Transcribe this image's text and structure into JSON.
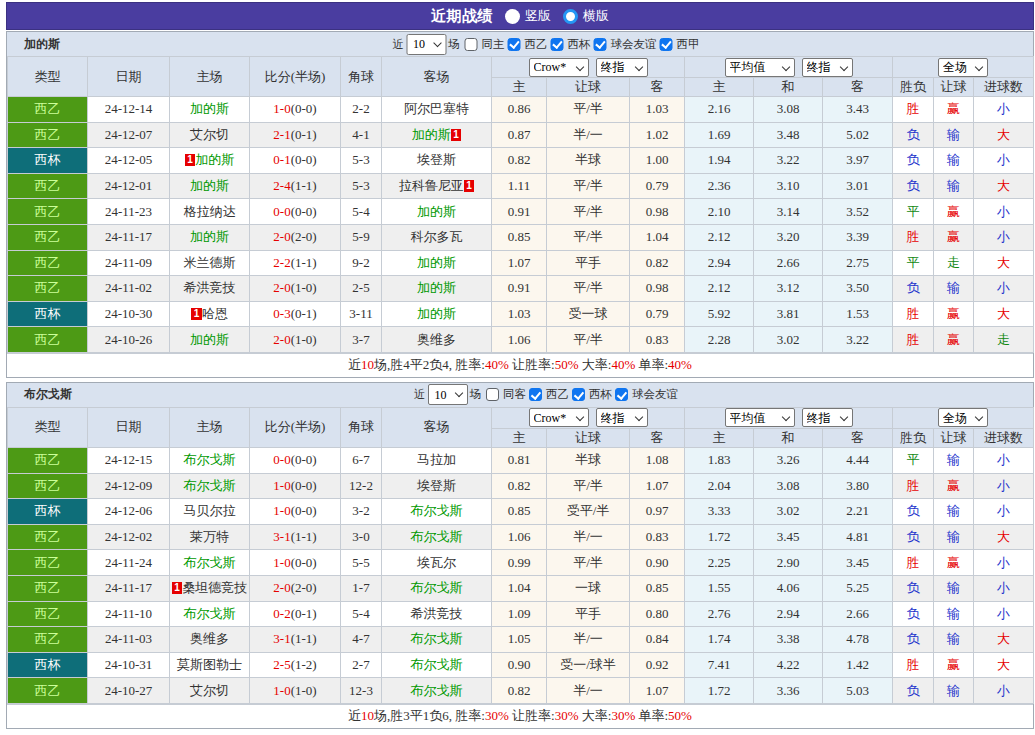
{
  "topbar": {
    "title": "近期战绩",
    "radios": [
      {
        "label": "竖版",
        "checked": false
      },
      {
        "label": "横版",
        "checked": true
      }
    ]
  },
  "header_cols_left": [
    "类型",
    "日期",
    "主场",
    "比分(半场)",
    "角球",
    "客场"
  ],
  "odds_groups": [
    {
      "selects": [
        "Crow*",
        "终指"
      ],
      "cols": [
        "主",
        "让球",
        "客"
      ]
    },
    {
      "selects": [
        "平均值",
        "终指"
      ],
      "cols": [
        "主",
        "和",
        "客"
      ]
    },
    {
      "selects": [
        "全场"
      ],
      "cols": [
        "胜负",
        "让球",
        "进球数"
      ]
    }
  ],
  "colors": {
    "topbar": "#4a3da0",
    "league_badge": "#4d9a15",
    "cup_badge": "#0e6e79",
    "self_team": "#009900",
    "score_red": "#e60000",
    "win_red": "#e60000",
    "lose_blue": "#2233cc",
    "draw_green": "#118811"
  },
  "sections": [
    {
      "team": "加的斯",
      "controls": {
        "prefix": "近",
        "count": "10",
        "suffix": "场",
        "checkboxes": [
          {
            "key": "same-home",
            "label": "同主",
            "checked": false
          },
          {
            "key": "laliga2",
            "label": "西乙",
            "checked": true
          },
          {
            "key": "copa",
            "label": "西杯",
            "checked": true
          },
          {
            "key": "club-friendly",
            "label": "球会友谊",
            "checked": true
          },
          {
            "key": "laliga",
            "label": "西甲",
            "checked": true
          }
        ]
      },
      "rows": [
        {
          "type": "西乙",
          "cup": false,
          "date": "24-12-14",
          "home": {
            "name": "加的斯",
            "self": true,
            "badge": ""
          },
          "score": "1-0",
          "half": "(0-0)",
          "corner": "2-2",
          "away": {
            "name": "阿尔巴塞特",
            "self": false,
            "badge": ""
          },
          "asian": [
            "0.86",
            "平/半",
            "1.03"
          ],
          "euro": [
            "2.16",
            "3.08",
            "3.43"
          ],
          "outcome": [
            [
              "胜",
              "r"
            ],
            [
              "赢",
              "r"
            ],
            [
              "小",
              "b"
            ]
          ]
        },
        {
          "type": "西乙",
          "cup": false,
          "date": "24-12-07",
          "home": {
            "name": "艾尔切",
            "self": false,
            "badge": ""
          },
          "score": "2-1",
          "half": "(0-1)",
          "corner": "4-1",
          "away": {
            "name": "加的斯",
            "self": true,
            "badge": "1"
          },
          "asian": [
            "0.87",
            "半/一",
            "1.02"
          ],
          "euro": [
            "1.69",
            "3.48",
            "5.02"
          ],
          "outcome": [
            [
              "负",
              "b"
            ],
            [
              "输",
              "b"
            ],
            [
              "大",
              "r"
            ]
          ]
        },
        {
          "type": "西杯",
          "cup": true,
          "date": "24-12-05",
          "home": {
            "name": "加的斯",
            "self": true,
            "badge": "1"
          },
          "score": "0-1",
          "half": "(0-0)",
          "corner": "5-3",
          "away": {
            "name": "埃登斯",
            "self": false,
            "badge": ""
          },
          "asian": [
            "0.82",
            "半球",
            "1.00"
          ],
          "euro": [
            "1.94",
            "3.22",
            "3.97"
          ],
          "outcome": [
            [
              "负",
              "b"
            ],
            [
              "输",
              "b"
            ],
            [
              "小",
              "b"
            ]
          ]
        },
        {
          "type": "西乙",
          "cup": false,
          "date": "24-12-01",
          "home": {
            "name": "加的斯",
            "self": true,
            "badge": ""
          },
          "score": "2-4",
          "half": "(1-1)",
          "corner": "5-3",
          "away": {
            "name": "拉科鲁尼亚",
            "self": false,
            "badge": "1"
          },
          "asian": [
            "1.11",
            "平/半",
            "0.79"
          ],
          "euro": [
            "2.36",
            "3.10",
            "3.01"
          ],
          "outcome": [
            [
              "负",
              "b"
            ],
            [
              "输",
              "b"
            ],
            [
              "大",
              "r"
            ]
          ]
        },
        {
          "type": "西乙",
          "cup": false,
          "date": "24-11-23",
          "home": {
            "name": "格拉纳达",
            "self": false,
            "badge": ""
          },
          "score": "0-0",
          "half": "(0-0)",
          "corner": "5-4",
          "away": {
            "name": "加的斯",
            "self": true,
            "badge": ""
          },
          "asian": [
            "0.91",
            "平/半",
            "0.98"
          ],
          "euro": [
            "2.10",
            "3.14",
            "3.52"
          ],
          "outcome": [
            [
              "平",
              "g"
            ],
            [
              "赢",
              "r"
            ],
            [
              "小",
              "b"
            ]
          ]
        },
        {
          "type": "西乙",
          "cup": false,
          "date": "24-11-17",
          "home": {
            "name": "加的斯",
            "self": true,
            "badge": ""
          },
          "score": "2-0",
          "half": "(2-0)",
          "corner": "5-9",
          "away": {
            "name": "科尔多瓦",
            "self": false,
            "badge": ""
          },
          "asian": [
            "0.85",
            "平/半",
            "1.04"
          ],
          "euro": [
            "2.12",
            "3.20",
            "3.39"
          ],
          "outcome": [
            [
              "胜",
              "r"
            ],
            [
              "赢",
              "r"
            ],
            [
              "小",
              "b"
            ]
          ]
        },
        {
          "type": "西乙",
          "cup": false,
          "date": "24-11-09",
          "home": {
            "name": "米兰德斯",
            "self": false,
            "badge": ""
          },
          "score": "2-2",
          "half": "(1-1)",
          "corner": "9-2",
          "away": {
            "name": "加的斯",
            "self": true,
            "badge": ""
          },
          "asian": [
            "1.07",
            "平手",
            "0.82"
          ],
          "euro": [
            "2.94",
            "2.66",
            "2.75"
          ],
          "outcome": [
            [
              "平",
              "g"
            ],
            [
              "走",
              "g"
            ],
            [
              "大",
              "r"
            ]
          ]
        },
        {
          "type": "西乙",
          "cup": false,
          "date": "24-11-02",
          "home": {
            "name": "希洪竞技",
            "self": false,
            "badge": ""
          },
          "score": "2-0",
          "half": "(1-0)",
          "corner": "2-5",
          "away": {
            "name": "加的斯",
            "self": true,
            "badge": ""
          },
          "asian": [
            "0.91",
            "平/半",
            "0.98"
          ],
          "euro": [
            "2.12",
            "3.12",
            "3.50"
          ],
          "outcome": [
            [
              "负",
              "b"
            ],
            [
              "输",
              "b"
            ],
            [
              "小",
              "b"
            ]
          ]
        },
        {
          "type": "西杯",
          "cup": true,
          "date": "24-10-30",
          "home": {
            "name": "哈恩",
            "self": false,
            "badge": "1"
          },
          "score": "0-3",
          "half": "(0-1)",
          "corner": "3-11",
          "away": {
            "name": "加的斯",
            "self": true,
            "badge": ""
          },
          "asian": [
            "1.03",
            "受一球",
            "0.79"
          ],
          "euro": [
            "5.92",
            "3.81",
            "1.53"
          ],
          "outcome": [
            [
              "胜",
              "r"
            ],
            [
              "赢",
              "r"
            ],
            [
              "大",
              "r"
            ]
          ]
        },
        {
          "type": "西乙",
          "cup": false,
          "date": "24-10-26",
          "home": {
            "name": "加的斯",
            "self": true,
            "badge": ""
          },
          "score": "2-0",
          "half": "(1-0)",
          "corner": "3-7",
          "away": {
            "name": "奥维多",
            "self": false,
            "badge": ""
          },
          "asian": [
            "1.06",
            "平/半",
            "0.83"
          ],
          "euro": [
            "2.28",
            "3.02",
            "3.22"
          ],
          "outcome": [
            [
              "胜",
              "r"
            ],
            [
              "赢",
              "r"
            ],
            [
              "走",
              "g"
            ]
          ]
        }
      ],
      "summary": [
        [
          "近",
          "k"
        ],
        [
          "10",
          "r"
        ],
        [
          "场,胜4平2负4, 胜率:",
          "k"
        ],
        [
          "40%",
          "r"
        ],
        [
          " 让胜率:",
          "k"
        ],
        [
          "50%",
          "r"
        ],
        [
          " 大率:",
          "k"
        ],
        [
          "40%",
          "r"
        ],
        [
          " 单率:",
          "k"
        ],
        [
          "40%",
          "r"
        ]
      ]
    },
    {
      "team": "布尔戈斯",
      "controls": {
        "prefix": "近",
        "count": "10",
        "suffix": "场",
        "checkboxes": [
          {
            "key": "same-away",
            "label": "同客",
            "checked": false
          },
          {
            "key": "laliga2",
            "label": "西乙",
            "checked": true
          },
          {
            "key": "copa",
            "label": "西杯",
            "checked": true
          },
          {
            "key": "club-friendly",
            "label": "球会友谊",
            "checked": true
          }
        ]
      },
      "rows": [
        {
          "type": "西乙",
          "cup": false,
          "date": "24-12-15",
          "home": {
            "name": "布尔戈斯",
            "self": true,
            "badge": ""
          },
          "score": "0-0",
          "half": "(0-0)",
          "corner": "6-7",
          "away": {
            "name": "马拉加",
            "self": false,
            "badge": ""
          },
          "asian": [
            "0.81",
            "半球",
            "1.08"
          ],
          "euro": [
            "1.83",
            "3.26",
            "4.44"
          ],
          "outcome": [
            [
              "平",
              "g"
            ],
            [
              "输",
              "b"
            ],
            [
              "小",
              "b"
            ]
          ]
        },
        {
          "type": "西乙",
          "cup": false,
          "date": "24-12-09",
          "home": {
            "name": "布尔戈斯",
            "self": true,
            "badge": ""
          },
          "score": "1-0",
          "half": "(0-0)",
          "corner": "12-2",
          "away": {
            "name": "埃登斯",
            "self": false,
            "badge": ""
          },
          "asian": [
            "0.82",
            "平/半",
            "1.07"
          ],
          "euro": [
            "2.04",
            "3.08",
            "3.80"
          ],
          "outcome": [
            [
              "胜",
              "r"
            ],
            [
              "赢",
              "r"
            ],
            [
              "小",
              "b"
            ]
          ]
        },
        {
          "type": "西杯",
          "cup": true,
          "date": "24-12-06",
          "home": {
            "name": "马贝尔拉",
            "self": false,
            "badge": ""
          },
          "score": "1-0",
          "half": "(0-0)",
          "corner": "3-2",
          "away": {
            "name": "布尔戈斯",
            "self": true,
            "badge": ""
          },
          "asian": [
            "0.85",
            "受平/半",
            "0.97"
          ],
          "euro": [
            "3.33",
            "3.02",
            "2.21"
          ],
          "outcome": [
            [
              "负",
              "b"
            ],
            [
              "输",
              "b"
            ],
            [
              "小",
              "b"
            ]
          ]
        },
        {
          "type": "西乙",
          "cup": false,
          "date": "24-12-02",
          "home": {
            "name": "莱万特",
            "self": false,
            "badge": ""
          },
          "score": "3-1",
          "half": "(1-1)",
          "corner": "3-0",
          "away": {
            "name": "布尔戈斯",
            "self": true,
            "badge": ""
          },
          "asian": [
            "1.06",
            "半/一",
            "0.83"
          ],
          "euro": [
            "1.72",
            "3.45",
            "4.81"
          ],
          "outcome": [
            [
              "负",
              "b"
            ],
            [
              "输",
              "b"
            ],
            [
              "大",
              "r"
            ]
          ]
        },
        {
          "type": "西乙",
          "cup": false,
          "date": "24-11-24",
          "home": {
            "name": "布尔戈斯",
            "self": true,
            "badge": ""
          },
          "score": "1-0",
          "half": "(0-0)",
          "corner": "5-5",
          "away": {
            "name": "埃瓦尔",
            "self": false,
            "badge": ""
          },
          "asian": [
            "0.99",
            "平/半",
            "0.90"
          ],
          "euro": [
            "2.25",
            "2.90",
            "3.45"
          ],
          "outcome": [
            [
              "胜",
              "r"
            ],
            [
              "赢",
              "r"
            ],
            [
              "小",
              "b"
            ]
          ]
        },
        {
          "type": "西乙",
          "cup": false,
          "date": "24-11-17",
          "home": {
            "name": "桑坦德竞技",
            "self": false,
            "badge": "1"
          },
          "score": "2-0",
          "half": "(2-0)",
          "corner": "1-7",
          "away": {
            "name": "布尔戈斯",
            "self": true,
            "badge": ""
          },
          "asian": [
            "1.04",
            "一球",
            "0.85"
          ],
          "euro": [
            "1.55",
            "4.06",
            "5.25"
          ],
          "outcome": [
            [
              "负",
              "b"
            ],
            [
              "输",
              "b"
            ],
            [
              "小",
              "b"
            ]
          ]
        },
        {
          "type": "西乙",
          "cup": false,
          "date": "24-11-10",
          "home": {
            "name": "布尔戈斯",
            "self": true,
            "badge": ""
          },
          "score": "0-2",
          "half": "(0-1)",
          "corner": "5-4",
          "away": {
            "name": "希洪竞技",
            "self": false,
            "badge": ""
          },
          "asian": [
            "1.09",
            "平手",
            "0.80"
          ],
          "euro": [
            "2.76",
            "2.94",
            "2.66"
          ],
          "outcome": [
            [
              "负",
              "b"
            ],
            [
              "输",
              "b"
            ],
            [
              "小",
              "b"
            ]
          ]
        },
        {
          "type": "西乙",
          "cup": false,
          "date": "24-11-03",
          "home": {
            "name": "奥维多",
            "self": false,
            "badge": ""
          },
          "score": "3-1",
          "half": "(1-1)",
          "corner": "4-7",
          "away": {
            "name": "布尔戈斯",
            "self": true,
            "badge": ""
          },
          "asian": [
            "1.05",
            "半/一",
            "0.84"
          ],
          "euro": [
            "1.74",
            "3.38",
            "4.78"
          ],
          "outcome": [
            [
              "负",
              "b"
            ],
            [
              "输",
              "b"
            ],
            [
              "大",
              "r"
            ]
          ]
        },
        {
          "type": "西杯",
          "cup": true,
          "date": "24-10-31",
          "home": {
            "name": "莫斯图勒士",
            "self": false,
            "badge": ""
          },
          "score": "2-5",
          "half": "(1-2)",
          "corner": "2-7",
          "away": {
            "name": "布尔戈斯",
            "self": true,
            "badge": ""
          },
          "asian": [
            "0.90",
            "受一/球半",
            "0.92"
          ],
          "euro": [
            "7.41",
            "4.22",
            "1.42"
          ],
          "outcome": [
            [
              "胜",
              "r"
            ],
            [
              "赢",
              "r"
            ],
            [
              "大",
              "r"
            ]
          ]
        },
        {
          "type": "西乙",
          "cup": false,
          "date": "24-10-27",
          "home": {
            "name": "艾尔切",
            "self": false,
            "badge": ""
          },
          "score": "1-0",
          "half": "(1-0)",
          "corner": "12-3",
          "away": {
            "name": "布尔戈斯",
            "self": true,
            "badge": ""
          },
          "asian": [
            "0.82",
            "半/一",
            "1.07"
          ],
          "euro": [
            "1.72",
            "3.36",
            "5.03"
          ],
          "outcome": [
            [
              "负",
              "b"
            ],
            [
              "输",
              "b"
            ],
            [
              "小",
              "b"
            ]
          ]
        }
      ],
      "summary": [
        [
          "近",
          "k"
        ],
        [
          "10",
          "r"
        ],
        [
          "场,胜3平1负6, 胜率:",
          "k"
        ],
        [
          "30%",
          "r"
        ],
        [
          " 让胜率:",
          "k"
        ],
        [
          "30%",
          "r"
        ],
        [
          " 大率:",
          "k"
        ],
        [
          "30%",
          "r"
        ],
        [
          " 单率:",
          "k"
        ],
        [
          "50%",
          "r"
        ]
      ]
    }
  ]
}
